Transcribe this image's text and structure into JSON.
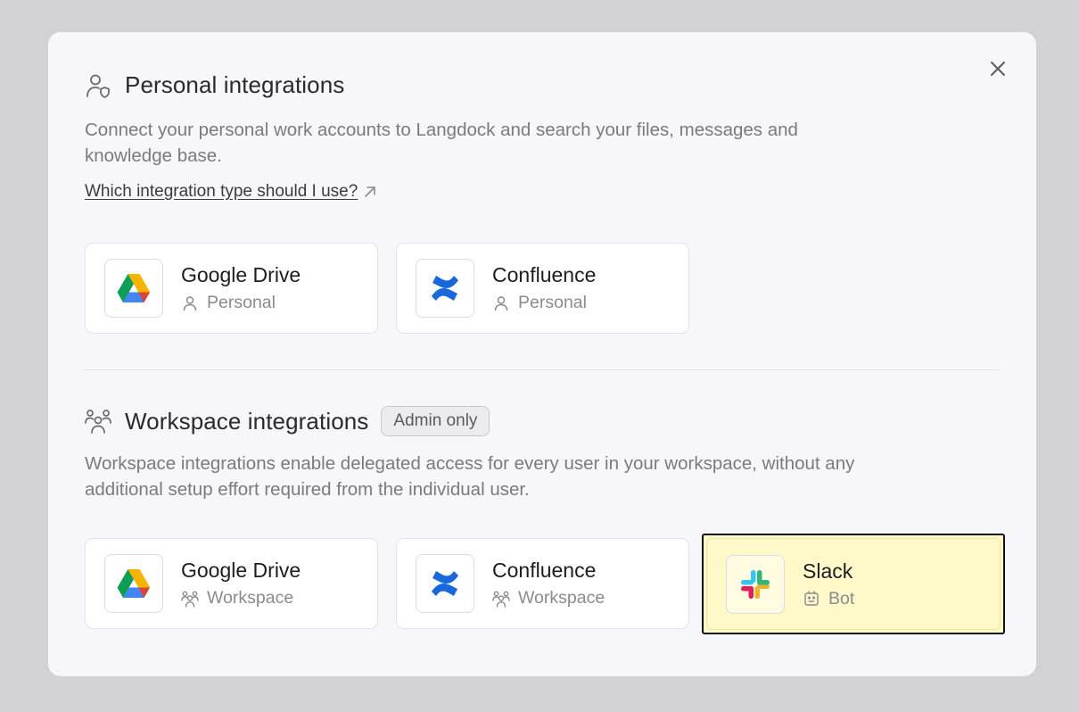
{
  "personal": {
    "title": "Personal integrations",
    "icon": "user-shield-icon",
    "description": "Connect your personal work accounts to Langdock and search your files, messages and knowledge base.",
    "help_link": "Which integration type should I use?",
    "cards": [
      {
        "name": "Google Drive",
        "type": "Personal",
        "logo": "google-drive-logo"
      },
      {
        "name": "Confluence",
        "type": "Personal",
        "logo": "confluence-logo"
      }
    ]
  },
  "workspace": {
    "title": "Workspace integrations",
    "icon": "users-icon",
    "badge": "Admin only",
    "description": "Workspace integrations enable delegated access for every user in your workspace, without any additional setup effort required from the individual user.",
    "cards": [
      {
        "name": "Google Drive",
        "type": "Workspace",
        "logo": "google-drive-logo"
      },
      {
        "name": "Confluence",
        "type": "Workspace",
        "logo": "confluence-logo"
      },
      {
        "name": "Slack",
        "type": "Bot",
        "logo": "slack-logo",
        "selected": true
      }
    ]
  },
  "colors": {
    "selected_bg": "#fff9c9",
    "drive_green": "#0f9d58",
    "drive_yellow": "#f4b400",
    "drive_blue": "#4285f4",
    "confluence_blue": "#1868db"
  }
}
